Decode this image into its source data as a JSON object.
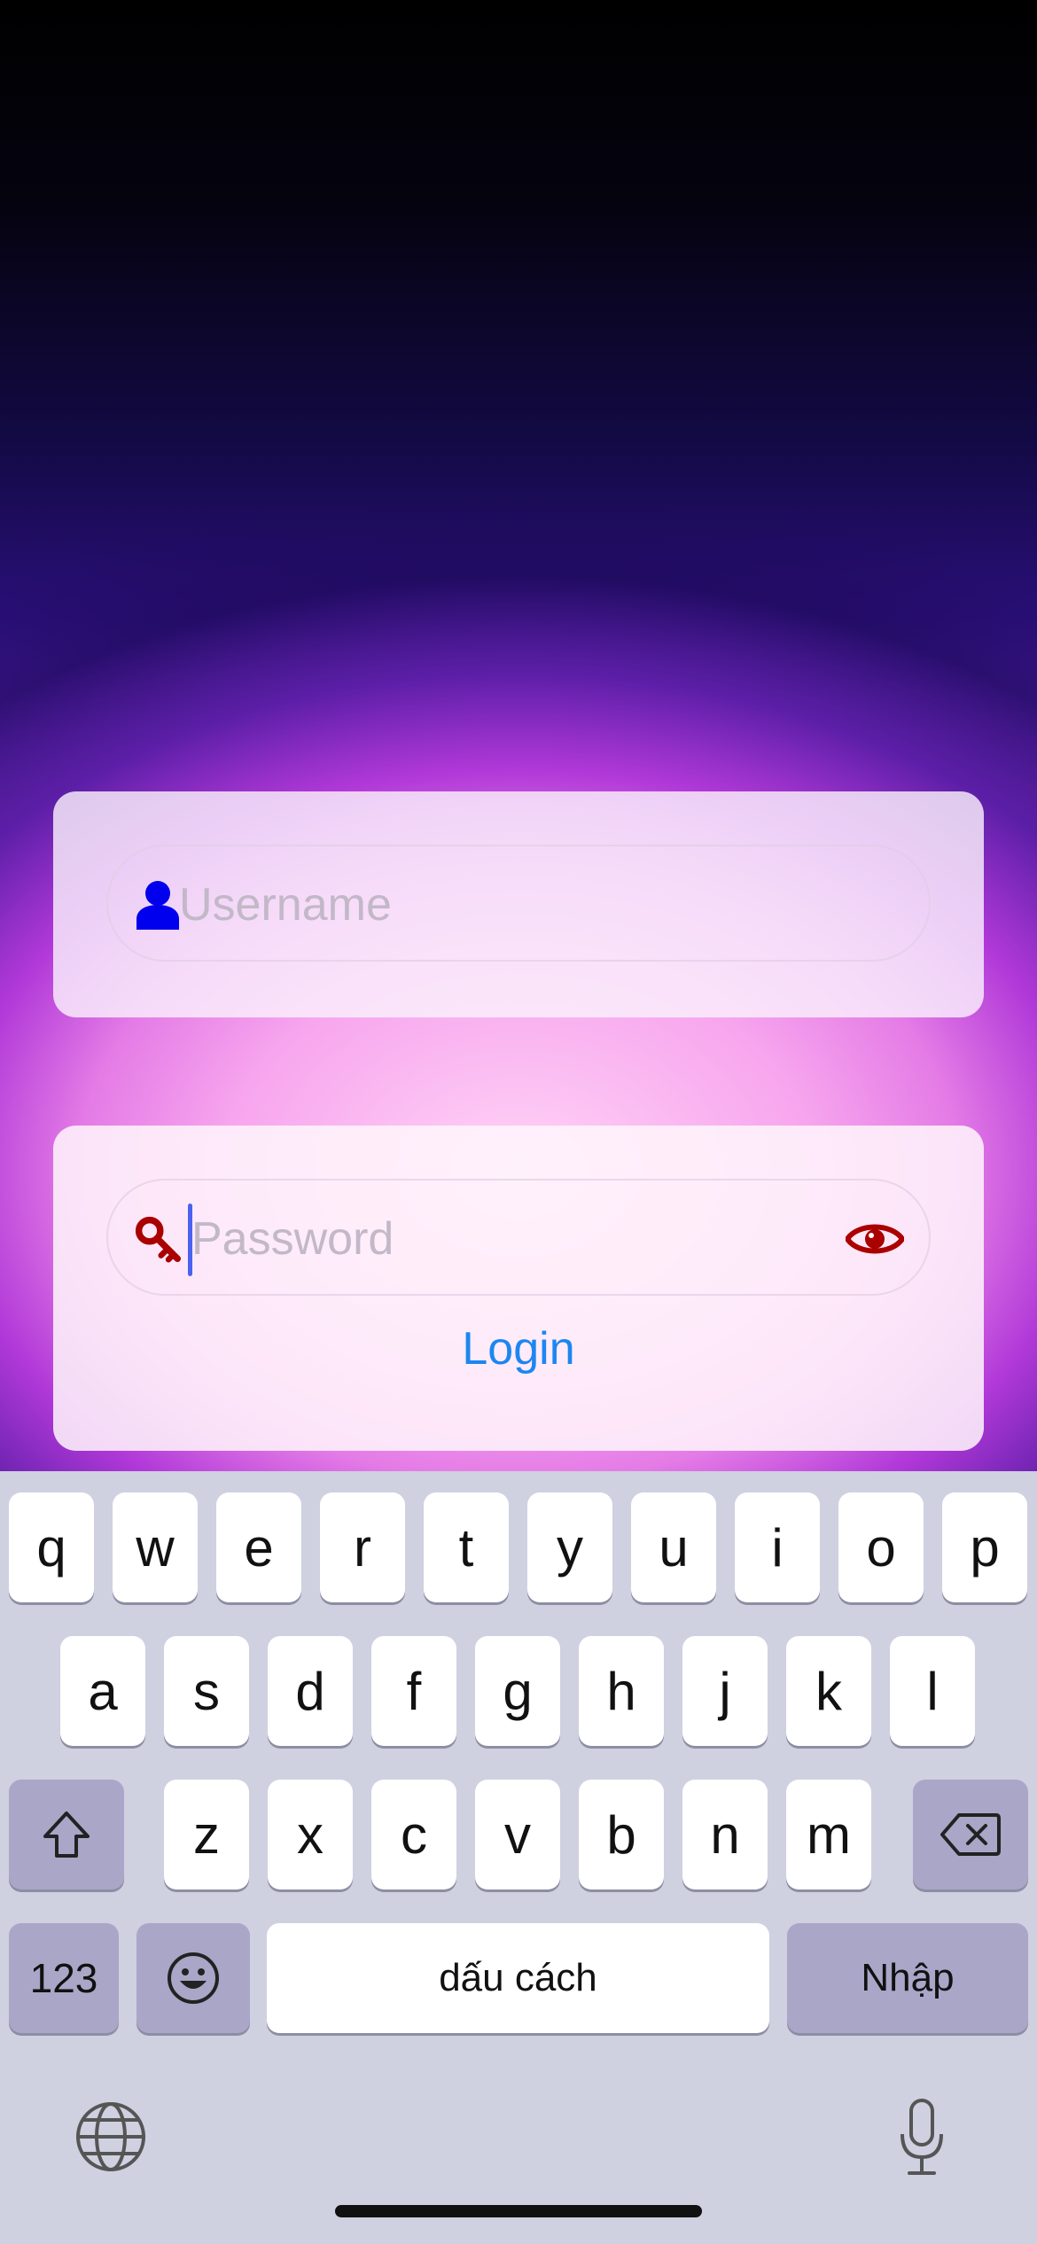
{
  "login_form": {
    "username_placeholder": "Username",
    "password_placeholder": "Password",
    "login_label": "Login"
  },
  "icons": {
    "username": "person-icon",
    "password": "key-icon",
    "toggle_visibility": "eye-icon",
    "shift": "shift-icon",
    "backspace": "backspace-icon",
    "emoji": "emoji-icon",
    "globe": "globe-icon",
    "mic": "microphone-icon"
  },
  "colors": {
    "username_icon": "#0000ee",
    "password_icon": "#aa0000",
    "login_link": "#1d86f0",
    "caret": "#4a62f0"
  },
  "keyboard": {
    "row1": [
      "q",
      "w",
      "e",
      "r",
      "t",
      "y",
      "u",
      "i",
      "o",
      "p"
    ],
    "row2": [
      "a",
      "s",
      "d",
      "f",
      "g",
      "h",
      "j",
      "k",
      "l"
    ],
    "row3": [
      "z",
      "x",
      "c",
      "v",
      "b",
      "n",
      "m"
    ],
    "numbers_label": "123",
    "space_label": "dấu cách",
    "return_label": "Nhập"
  }
}
